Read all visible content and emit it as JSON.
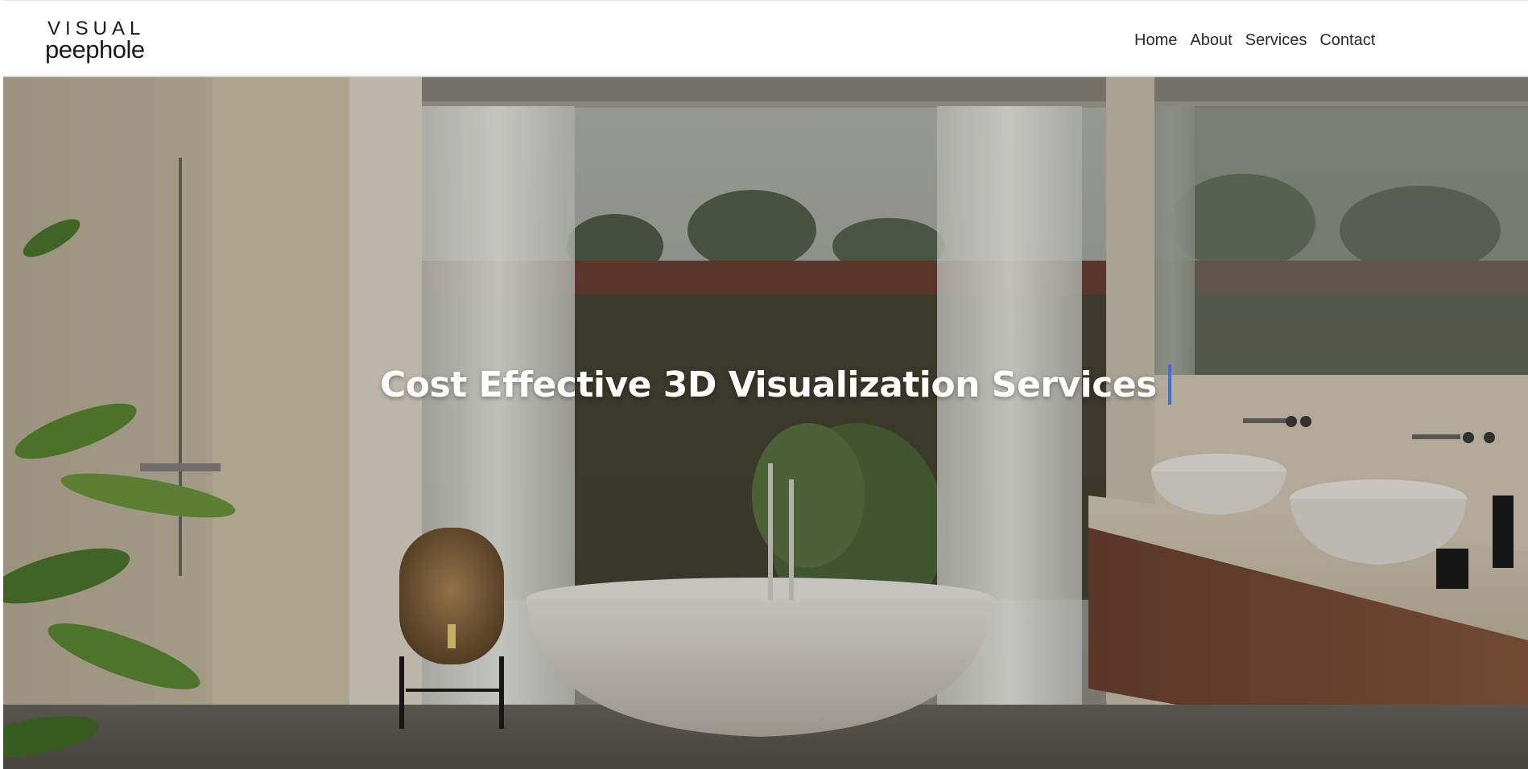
{
  "brand": {
    "logo_top": "VISUAL",
    "logo_bottom": "peephole"
  },
  "nav": {
    "items": [
      "Home",
      "About",
      "Services",
      "Contact"
    ]
  },
  "hero": {
    "title": "Cost Effective 3D Visualization Services",
    "image": "bathroom-interior-render",
    "caret_color": "#3a6fd8"
  }
}
